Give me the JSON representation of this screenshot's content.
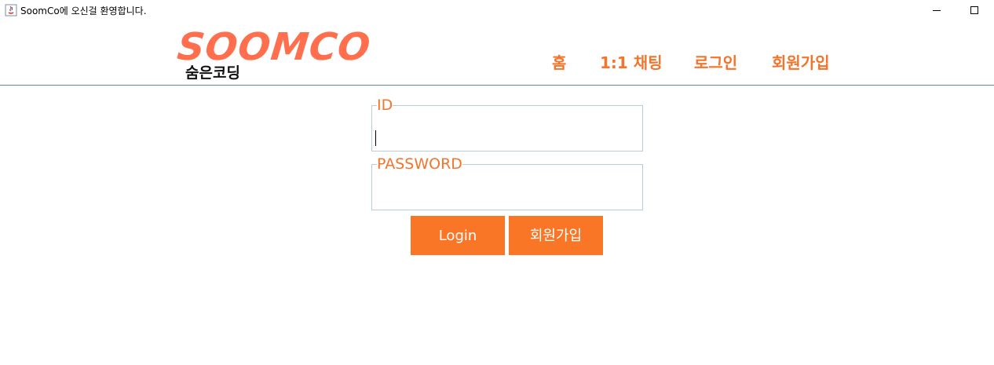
{
  "window": {
    "title": "SoomCo에 오신걸 환영합니다."
  },
  "header": {
    "logo_main": "SOOMCO",
    "logo_sub": "숨은코딩",
    "nav": {
      "home": "홈",
      "chat": "1:1 채팅",
      "login": "로그인",
      "signup": "회원가입"
    }
  },
  "form": {
    "id_label": "ID",
    "id_value": "",
    "password_label": "PASSWORD",
    "password_value": "",
    "login_button": "Login",
    "signup_button": "회원가입"
  },
  "colors": {
    "accent": "#f4742c",
    "button_bg": "#fa7627",
    "logo": "#ff6f4e",
    "divider": "#5f8a8b",
    "field_border": "#b8cdd4"
  },
  "icons": {
    "app": "java-app-icon",
    "minimize": "minimize-icon",
    "maximize": "maximize-icon"
  }
}
